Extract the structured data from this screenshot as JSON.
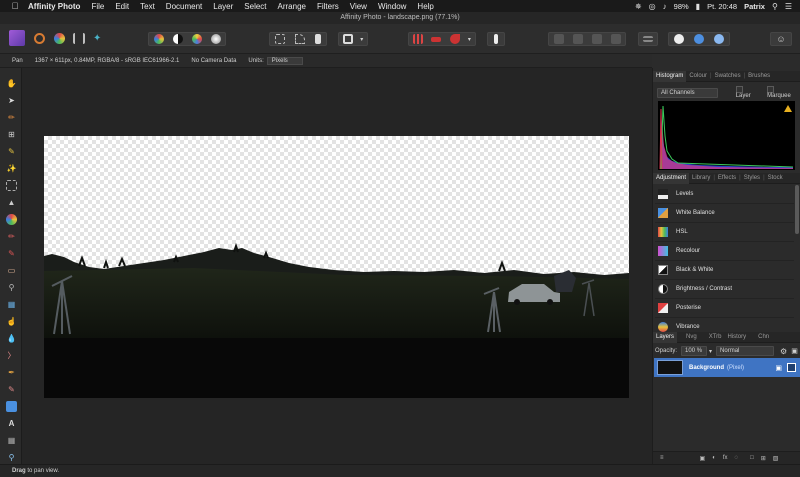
{
  "menubar": {
    "app_name": "Affinity Photo",
    "items": [
      "File",
      "Edit",
      "Text",
      "Document",
      "Layer",
      "Select",
      "Arrange",
      "Filters",
      "View",
      "Window",
      "Help"
    ],
    "battery": "98%",
    "clock": "Pt. 20:48",
    "user": "Patrix"
  },
  "window": {
    "title": "Affinity Photo - landscape.png (77.1%)"
  },
  "context": {
    "tool": "Pan",
    "doc_info": "1367 × 611px, 0.84MP, RGBA/8 - sRGB IEC61966-2.1",
    "camera": "No Camera Data",
    "units_label": "Units:",
    "units_value": "Pixels"
  },
  "histogram_panel": {
    "tabs": [
      "Histogram",
      "Colour",
      "Swatches",
      "Brushes"
    ],
    "channel": "All Channels",
    "layer_label": "Layer",
    "marquee_label": "Marquee",
    "warning_icon": "warning-triangle-icon"
  },
  "adjustment_panel": {
    "tabs": [
      "Adjustment",
      "Library",
      "Effects",
      "Styles",
      "Stock"
    ],
    "items": [
      {
        "label": "Levels",
        "icon": "levels-icon"
      },
      {
        "label": "White Balance",
        "icon": "white-balance-icon"
      },
      {
        "label": "HSL",
        "icon": "hsl-icon"
      },
      {
        "label": "Recolour",
        "icon": "recolour-icon"
      },
      {
        "label": "Black & White",
        "icon": "black-white-icon"
      },
      {
        "label": "Brightness / Contrast",
        "icon": "brightness-contrast-icon"
      },
      {
        "label": "Posterise",
        "icon": "posterise-icon"
      },
      {
        "label": "Vibrance",
        "icon": "vibrance-icon"
      }
    ]
  },
  "layers_panel": {
    "tabs": [
      "Layers",
      "Nvg",
      "XTrb",
      "History",
      "Chn"
    ],
    "opacity_label": "Opacity:",
    "opacity_value": "100 %",
    "blend_mode": "Normal",
    "layer": {
      "name": "Background",
      "kind": "(Pixel)"
    }
  },
  "status": {
    "bold": "Drag",
    "rest": " to pan view."
  },
  "colors": {
    "accent": "#3f74c3",
    "bg": "#2b2b2b"
  }
}
